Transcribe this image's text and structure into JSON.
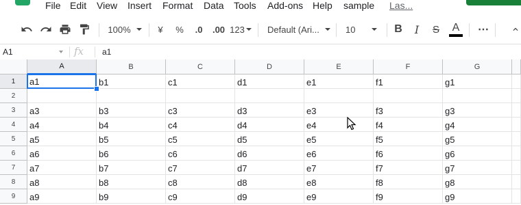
{
  "menu": [
    "File",
    "Edit",
    "View",
    "Insert",
    "Format",
    "Data",
    "Tools",
    "Add-ons",
    "Help",
    "sample",
    "Las..."
  ],
  "toolbar": {
    "zoom": "100%",
    "currency": "¥",
    "percent": "%",
    "decrease_decimal": ".0",
    "increase_decimal": ".00",
    "number_format": "123",
    "font": "Default (Ari...",
    "font_size": "10",
    "bold": "B",
    "italic": "I",
    "strikethrough": "S",
    "text_color": "A",
    "more": "⋯"
  },
  "formula_bar": {
    "name_box": "A1",
    "fx": "fx",
    "value": "a1"
  },
  "columns": [
    "A",
    "B",
    "C",
    "D",
    "E",
    "F",
    "G"
  ],
  "rows": [
    {
      "num": "1",
      "cells": [
        "a1",
        "b1",
        "c1",
        "d1",
        "e1",
        "f1",
        "g1"
      ]
    },
    {
      "num": "2",
      "cells": [
        "",
        "",
        "",
        "",
        "",
        "",
        ""
      ]
    },
    {
      "num": "3",
      "cells": [
        "a3",
        "b3",
        "c3",
        "d3",
        "e3",
        "f3",
        "g3"
      ]
    },
    {
      "num": "4",
      "cells": [
        "a4",
        "b4",
        "c4",
        "d4",
        "e4",
        "f4",
        "g4"
      ]
    },
    {
      "num": "5",
      "cells": [
        "a5",
        "b5",
        "c5",
        "d5",
        "e5",
        "f5",
        "g5"
      ]
    },
    {
      "num": "6",
      "cells": [
        "a6",
        "b6",
        "c6",
        "d6",
        "e6",
        "f6",
        "g6"
      ]
    },
    {
      "num": "7",
      "cells": [
        "a7",
        "b7",
        "c7",
        "d7",
        "e7",
        "f7",
        "g7"
      ]
    },
    {
      "num": "8",
      "cells": [
        "a8",
        "b8",
        "c8",
        "d8",
        "e8",
        "f8",
        "g8"
      ]
    },
    {
      "num": "9",
      "cells": [
        "a9",
        "b9",
        "c9",
        "d9",
        "e9",
        "f9",
        "g9"
      ]
    }
  ],
  "selected_cell": "A1",
  "colors": {
    "accent": "#1a73e8",
    "brand_green": "#188038",
    "header_bg": "#f8f9fa"
  }
}
